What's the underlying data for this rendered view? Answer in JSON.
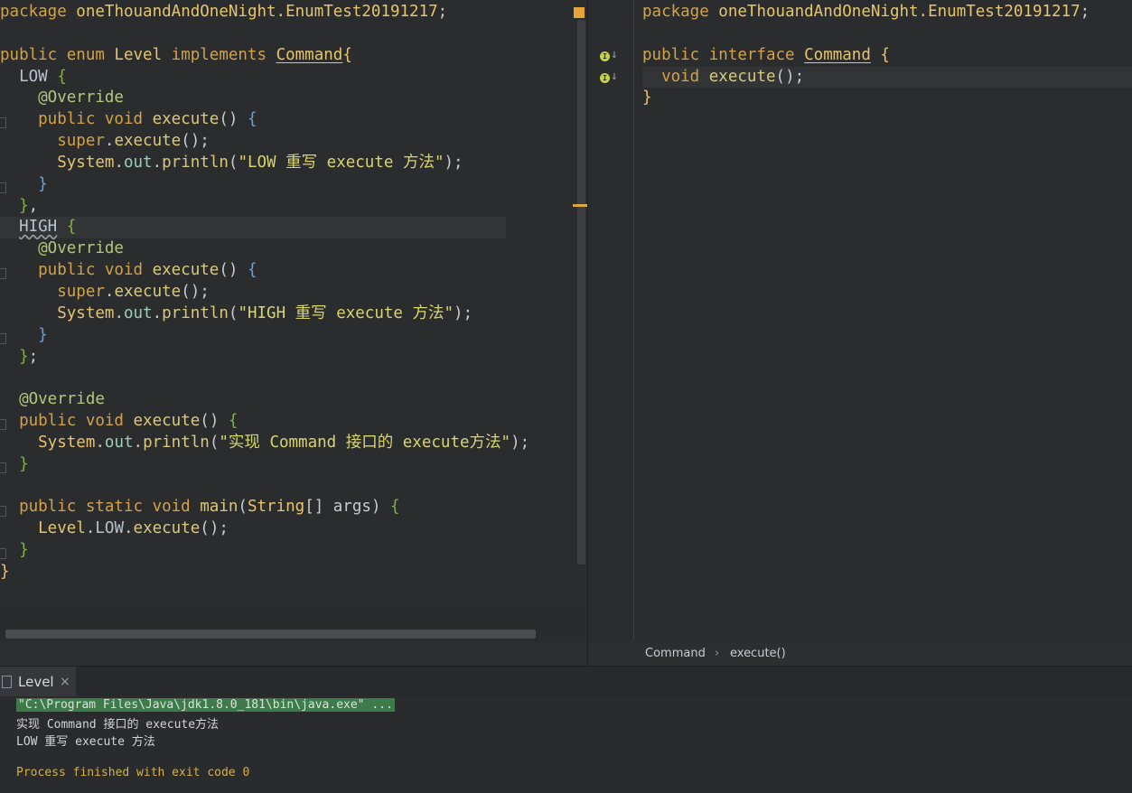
{
  "left_editor": {
    "lines": [
      "package oneThouandAndOneNight.EnumTest20191217;",
      "",
      "public enum Level implements Command{",
      "  LOW {",
      "    @Override",
      "    public void execute() {",
      "      super.execute();",
      "      System.out.println(\"LOW 重写 execute 方法\");",
      "    }",
      "  },",
      "  HIGH {",
      "    @Override",
      "    public void execute() {",
      "      super.execute();",
      "      System.out.println(\"HIGH 重写 execute 方法\");",
      "    }",
      "  };",
      "",
      "  @Override",
      "  public void execute() {",
      "    System.out.println(\"实现 Command 接口的 execute方法\");",
      "  }",
      "",
      "  public static void main(String[] args) {",
      "    Level.LOW.execute();",
      "  }",
      "}"
    ]
  },
  "right_editor": {
    "lines": [
      "package oneThouandAndOneNight.EnumTest20191217;",
      "",
      "public interface Command {",
      "  void execute();",
      "}"
    ]
  },
  "breadcrumb": {
    "items": [
      "Command",
      "execute()"
    ],
    "separator": "›"
  },
  "run_panel": {
    "tab_label": "Level",
    "close_glyph": "×",
    "console": [
      "\"C:\\Program Files\\Java\\jdk1.8.0_181\\bin\\java.exe\" ...",
      "实现 Command 接口的 execute方法",
      "LOW 重写 execute 方法",
      "",
      "Process finished with exit code 0"
    ]
  },
  "icons": {
    "run_tab": "console-icon",
    "gutter": "implemented-method-icon"
  },
  "colors": {
    "keyword": "#d3a24a",
    "annotation": "#b5c57c",
    "string": "#d8d470",
    "console_finished": "#d8b04a",
    "console_cmd_bg": "#3e7a4a"
  }
}
